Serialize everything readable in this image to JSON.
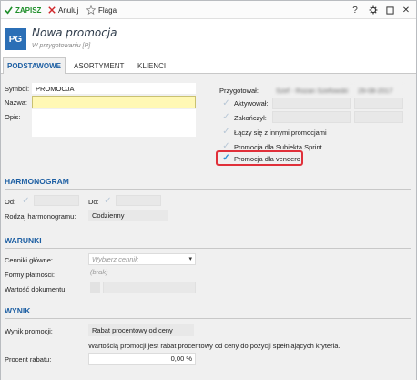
{
  "toolbar": {
    "save_label": "ZAPISZ",
    "cancel_label": "Anuluj",
    "flag_label": "Flaga",
    "help_label": "?",
    "settings_icon": "gear-icon",
    "maximize_icon": "square-icon",
    "close_label": "✕"
  },
  "header": {
    "badge": "PG",
    "title": "Nowa promocja",
    "subtitle": "W przygotowaniu [P]"
  },
  "tabs": [
    {
      "label": "PODSTAWOWE",
      "active": true
    },
    {
      "label": "ASORTYMENT",
      "active": false
    },
    {
      "label": "KLIENCI",
      "active": false
    }
  ],
  "basic": {
    "symbol_label": "Symbol:",
    "symbol_value": "PROMOCJA",
    "name_label": "Nazwa:",
    "name_value": "",
    "desc_label": "Opis:",
    "desc_value": ""
  },
  "status": {
    "prepared_label": "Przygotował:",
    "prepared_by": "Szef - Rozan Szefowski",
    "prepared_date": "29-08-2017",
    "activated_label": "Aktywował:",
    "finished_label": "Zakończył:",
    "combine_label": "Łączy się z innymi promocjami",
    "sprint_label": "Promocja dla Subiekta Sprint",
    "vendero_label": "Promocja dla vendero",
    "vendero_checked": true
  },
  "schedule": {
    "section": "HARMONOGRAM",
    "from_label": "Od:",
    "to_label": "Do:",
    "type_label": "Rodzaj harmonogramu:",
    "type_value": "Codzienny"
  },
  "conditions": {
    "section": "WARUNKI",
    "pricelist_label": "Cenniki główne:",
    "pricelist_placeholder": "Wybierz cennik",
    "payment_label": "Formy płatności:",
    "payment_value": "(brak)",
    "docvalue_label": "Wartość dokumentu:"
  },
  "result": {
    "section": "WYNIK",
    "result_label": "Wynik promocji:",
    "result_value": "Rabat procentowy od ceny",
    "description": "Wartością promocji jest rabat procentowy od ceny do pozycji spełniających kryteria.",
    "percent_label": "Procent rabatu:",
    "percent_value": "0,00 %"
  }
}
